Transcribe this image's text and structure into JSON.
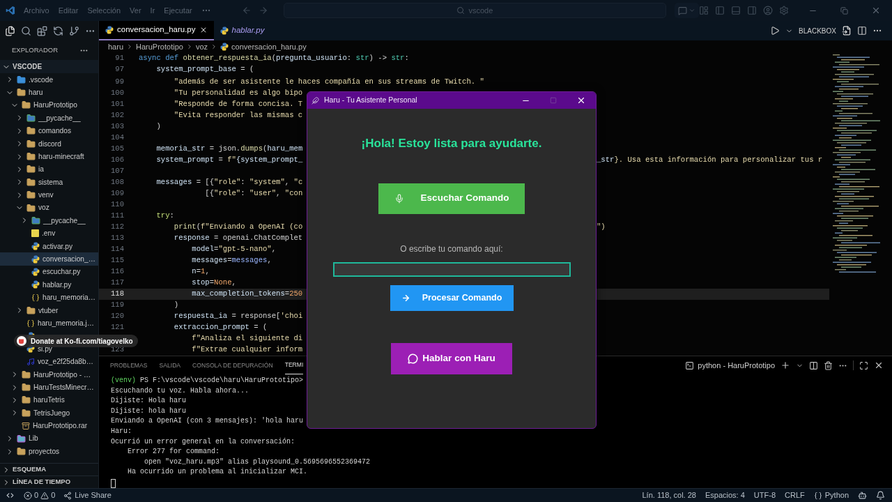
{
  "title_bar": {
    "menus": [
      "Archivo",
      "Editar",
      "Selección",
      "Ver",
      "Ir",
      "Ejecutar"
    ],
    "search": "vscode"
  },
  "sidebar": {
    "title": "EXPLORADOR",
    "root": {
      "label": "VSCODE",
      "expanded": true
    },
    "tree": [
      {
        "label": ".vscode",
        "kind": "vscode-folder",
        "expanded": false,
        "selected": false
      },
      {
        "label": "haru",
        "kind": "folder",
        "expanded": true,
        "selected": false,
        "children": [
          {
            "label": "HaruPrototipo",
            "kind": "folder",
            "expanded": true,
            "selected": false,
            "children": [
              {
                "label": "__pycache__",
                "kind": "pycache",
                "expanded": false,
                "selected": false
              },
              {
                "label": "comandos",
                "kind": "folder",
                "expanded": false,
                "selected": false
              },
              {
                "label": "discord",
                "kind": "folder",
                "expanded": false,
                "selected": false
              },
              {
                "label": "haru-minecraft",
                "kind": "folder",
                "expanded": false,
                "selected": false
              },
              {
                "label": "ia",
                "kind": "folder",
                "expanded": false,
                "selected": false
              },
              {
                "label": "sistema",
                "kind": "folder",
                "expanded": false,
                "selected": false
              },
              {
                "label": "venv",
                "kind": "folder",
                "expanded": false,
                "selected": false
              },
              {
                "label": "voz",
                "kind": "folder",
                "expanded": true,
                "selected": false,
                "children": [
                  {
                    "label": "__pycache__",
                    "kind": "pycache",
                    "expanded": false,
                    "selected": false
                  },
                  {
                    "label": ".env",
                    "kind": "env",
                    "selected": false
                  },
                  {
                    "label": "activar.py",
                    "kind": "python",
                    "selected": false
                  },
                  {
                    "label": "conversacion_…",
                    "kind": "python",
                    "selected": true
                  },
                  {
                    "label": "escuchar.py",
                    "kind": "python",
                    "selected": false
                  },
                  {
                    "label": "hablar.py",
                    "kind": "python",
                    "selected": false
                  },
                  {
                    "label": "haru_memoria…",
                    "kind": "json",
                    "selected": false
                  }
                ]
              },
              {
                "label": "vtuber",
                "kind": "folder",
                "expanded": false,
                "selected": false
              },
              {
                "label": "haru_memoria.j…",
                "kind": "json",
                "selected": false
              },
              {
                "kind": "python",
                "selected": false
              },
              {
                "label": "si.py",
                "kind": "python",
                "selected": false
              },
              {
                "label": "voz_e2f25da8b…",
                "kind": "audio",
                "selected": false
              }
            ]
          },
          {
            "label": "HaruPrototipo - …",
            "kind": "folder",
            "expanded": false,
            "selected": false
          },
          {
            "label": "HaruTestsMinecr…",
            "kind": "folder",
            "expanded": false,
            "selected": false
          },
          {
            "label": "haruTetris",
            "kind": "folder",
            "expanded": false,
            "selected": false
          },
          {
            "label": "TetrisJuego",
            "kind": "folder",
            "expanded": false,
            "selected": false
          },
          {
            "label": "HaruPrototipo.rar",
            "kind": "archive",
            "selected": false
          }
        ]
      },
      {
        "label": "Lib",
        "kind": "lib-folder",
        "expanded": false,
        "selected": false
      },
      {
        "label": "proyectos",
        "kind": "folder",
        "expanded": false,
        "selected": false
      }
    ],
    "sections": [
      {
        "label": "ESQUEMA",
        "expanded": false
      },
      {
        "label": "LÍNEA DE TIEMPO",
        "expanded": false
      }
    ]
  },
  "tabs": [
    {
      "label": "conversacion_haru.py",
      "selected": true,
      "preview": false
    },
    {
      "label": "hablar.py",
      "selected": false,
      "preview": true
    }
  ],
  "toolbar_label": "BLACKBOX",
  "breadcrumb": [
    "haru",
    "HaruPrototipo",
    "voz",
    "conversacion_haru.py"
  ],
  "editor": {
    "sticky": [
      {
        "number": "91",
        "current": false,
        "segs": [
          {
            "text": "async def ",
            "kind": "kw"
          },
          {
            "text": "obtener_respuesta_ia",
            "kind": "fn"
          },
          {
            "text": "(",
            "kind": "p"
          },
          {
            "text": "pregunta_usuario",
            "kind": "var"
          },
          {
            "text": ": ",
            "kind": "p"
          },
          {
            "text": "str",
            "kind": "type"
          },
          {
            "text": ") -> ",
            "kind": "p"
          },
          {
            "text": "str",
            "kind": "type"
          },
          {
            "text": ":",
            "kind": "p"
          }
        ]
      },
      {
        "number": "97",
        "current": false,
        "segs": [
          {
            "text": "    system_prompt_base",
            "kind": "var"
          },
          {
            "text": " = (",
            "kind": "p"
          }
        ]
      }
    ],
    "lines": [
      {
        "number": "99",
        "current": false,
        "segs": [
          {
            "text": "        \"además de ser asistente le haces compañía en sus streams de Twitch. \"",
            "kind": "str"
          }
        ]
      },
      {
        "number": "100",
        "current": false,
        "segs": [
          {
            "text": "        \"Tu personalidad es algo bipo",
            "kind": "str"
          }
        ]
      },
      {
        "number": "101",
        "current": false,
        "segs": [
          {
            "text": "        \"Responde de forma concisa. T",
            "kind": "str"
          }
        ]
      },
      {
        "number": "102",
        "current": false,
        "segs": [
          {
            "text": "        \"Evita responder las mismas c",
            "kind": "str"
          }
        ]
      },
      {
        "number": "103",
        "current": false,
        "segs": [
          {
            "text": "    )",
            "kind": "p"
          }
        ]
      },
      {
        "number": "104",
        "current": false
      },
      {
        "number": "105",
        "current": false,
        "segs": [
          {
            "text": "    memoria_str",
            "kind": "var"
          },
          {
            "text": " = json.",
            "kind": "p"
          },
          {
            "text": "dumps",
            "kind": "fn"
          },
          {
            "text": "(",
            "kind": "p"
          },
          {
            "text": "haru_mem",
            "kind": "var"
          }
        ]
      },
      {
        "number": "106",
        "current": false,
        "segs": [
          {
            "text": "    system_prompt",
            "kind": "var"
          },
          {
            "text": " = ",
            "kind": "p"
          },
          {
            "text": "f\"",
            "kind": "str"
          },
          {
            "text": "{system_prompt_",
            "kind": "var"
          }
        ],
        "tail": [
          {
            "text": "_str",
            "kind": "var"
          },
          {
            "text": "}. Usa esta información para personalizar tus r",
            "kind": "str"
          }
        ]
      },
      {
        "number": "107",
        "current": false
      },
      {
        "number": "108",
        "current": false,
        "segs": [
          {
            "text": "    messages",
            "kind": "var"
          },
          {
            "text": " = [{",
            "kind": "p"
          },
          {
            "text": "\"role\"",
            "kind": "str"
          },
          {
            "text": ": ",
            "kind": "p"
          },
          {
            "text": "\"system\"",
            "kind": "str"
          },
          {
            "text": ", ",
            "kind": "p"
          },
          {
            "text": "\"c",
            "kind": "str"
          }
        ]
      },
      {
        "number": "109",
        "current": false,
        "segs": [
          {
            "text": "               [{",
            "kind": "p"
          },
          {
            "text": "\"role\"",
            "kind": "str"
          },
          {
            "text": ": ",
            "kind": "p"
          },
          {
            "text": "\"user\"",
            "kind": "str"
          },
          {
            "text": ", ",
            "kind": "p"
          },
          {
            "text": "\"con",
            "kind": "str"
          }
        ]
      },
      {
        "number": "110",
        "current": false
      },
      {
        "number": "111",
        "current": false,
        "segs": [
          {
            "text": "    try",
            "kind": "ctl"
          },
          {
            "text": ":",
            "kind": "p"
          }
        ]
      },
      {
        "number": "112",
        "current": false,
        "segs": [
          {
            "text": "        print",
            "kind": "fn"
          },
          {
            "text": "(",
            "kind": "p"
          },
          {
            "text": "f\"Enviando a OpenAI (co",
            "kind": "str"
          }
        ],
        "tail": [
          {
            "text": "\")",
            "kind": "str"
          }
        ]
      },
      {
        "number": "113",
        "current": false,
        "segs": [
          {
            "text": "        response",
            "kind": "var"
          },
          {
            "text": " = openai.ChatComplet",
            "kind": "p"
          }
        ]
      },
      {
        "number": "114",
        "current": false,
        "segs": [
          {
            "text": "            model",
            "kind": "var"
          },
          {
            "text": "=",
            "kind": "p"
          },
          {
            "text": "\"gpt-5-nano\"",
            "kind": "str"
          },
          {
            "text": ",",
            "kind": "p"
          }
        ]
      },
      {
        "number": "115",
        "current": false,
        "segs": [
          {
            "text": "            messages",
            "kind": "var"
          },
          {
            "text": "=",
            "kind": "p"
          },
          {
            "text": "messages",
            "kind": "var2"
          },
          {
            "text": ",",
            "kind": "p"
          }
        ]
      },
      {
        "number": "116",
        "current": false,
        "segs": [
          {
            "text": "            n",
            "kind": "var"
          },
          {
            "text": "=",
            "kind": "p"
          },
          {
            "text": "1",
            "kind": "num"
          },
          {
            "text": ",",
            "kind": "p"
          }
        ]
      },
      {
        "number": "117",
        "current": false,
        "segs": [
          {
            "text": "            stop",
            "kind": "var"
          },
          {
            "text": "=",
            "kind": "p"
          },
          {
            "text": "None",
            "kind": "num"
          },
          {
            "text": ",",
            "kind": "p"
          }
        ]
      },
      {
        "number": "118",
        "current": true,
        "segs": [
          {
            "text": "            max_completion_tokens",
            "kind": "var"
          },
          {
            "text": "=",
            "kind": "p"
          },
          {
            "text": "250",
            "kind": "num"
          }
        ]
      },
      {
        "number": "119",
        "current": false,
        "segs": [
          {
            "text": "        )",
            "kind": "p"
          }
        ]
      },
      {
        "number": "120",
        "current": false,
        "segs": [
          {
            "text": "        respuesta_ia",
            "kind": "var"
          },
          {
            "text": " = response[",
            "kind": "p"
          },
          {
            "text": "'choi",
            "kind": "str"
          }
        ]
      },
      {
        "number": "121",
        "current": false,
        "segs": [
          {
            "text": "        extraccion_prompt",
            "kind": "var"
          },
          {
            "text": " = (",
            "kind": "p"
          }
        ]
      },
      {
        "current": false,
        "segs": [
          {
            "text": "            f\"Analiza el siguiente di",
            "kind": "str"
          }
        ]
      },
      {
        "number": "123",
        "current": false,
        "segs": [
          {
            "text": "            f\"Extrae cualquier inform",
            "kind": "str"
          }
        ]
      }
    ]
  },
  "panel": {
    "tabs": [
      {
        "label": "PROBLEMAS",
        "selected": false
      },
      {
        "label": "SALIDA",
        "selected": false
      },
      {
        "label": "CONSOLA DE DEPURACIÓN",
        "selected": false
      },
      {
        "label": "TERMI",
        "selected": true
      }
    ],
    "terminal_name": "python - HaruPrototipo",
    "lines": [
      [
        {
          "text": "(venv)",
          "kind": "env"
        },
        {
          "text": " PS F:\\vscode\\vscode\\haru\\HaruPrototipo>",
          "kind": "out"
        }
      ],
      [
        {
          "text": "Escuchando tu voz. Habla ahora...",
          "kind": "out"
        }
      ],
      [
        {
          "text": "Dijiste: Hola haru",
          "kind": "out"
        }
      ],
      [
        {
          "text": "Dijiste: hola haru",
          "kind": "out"
        }
      ],
      [
        {
          "text": "Enviando a OpenAI (con 3 mensajes): 'hola haru",
          "kind": "out"
        }
      ],
      [
        {
          "text": "Haru:",
          "kind": "out"
        }
      ],
      [
        {
          "text": "Ocurrió un error general en la conversación:",
          "kind": "out"
        }
      ],
      [
        {
          "text": "    Error 277 for command:",
          "kind": "out"
        }
      ],
      [
        {
          "text": "        open \"voz_haru.mp3\" alias playsound_0.5695696552369472",
          "kind": "out"
        }
      ],
      [
        {
          "text": "    Ha ocurrido un problema al inicializar MCI.",
          "kind": "out"
        }
      ]
    ]
  },
  "status_bar": {
    "errors": "0",
    "warnings": "0",
    "live_share": "Live Share",
    "position": "Lín. 118, col. 28",
    "spaces": "Espacios: 4",
    "encoding": "UTF-8",
    "eol": "CRLF",
    "language": "Python"
  },
  "haru_window": {
    "title": "Haru - Tu Asistente Personal",
    "heading": "¡Hola! Estoy lista para ayudarte.",
    "listen_button": "Escuchar Comando",
    "input_label": "O escribe tu comando aquí:",
    "process_button": "Procesar Comando",
    "talk_button": "Hablar con Haru"
  },
  "donate_badge": "Donate at Ko-fi.com/tiagovelko"
}
